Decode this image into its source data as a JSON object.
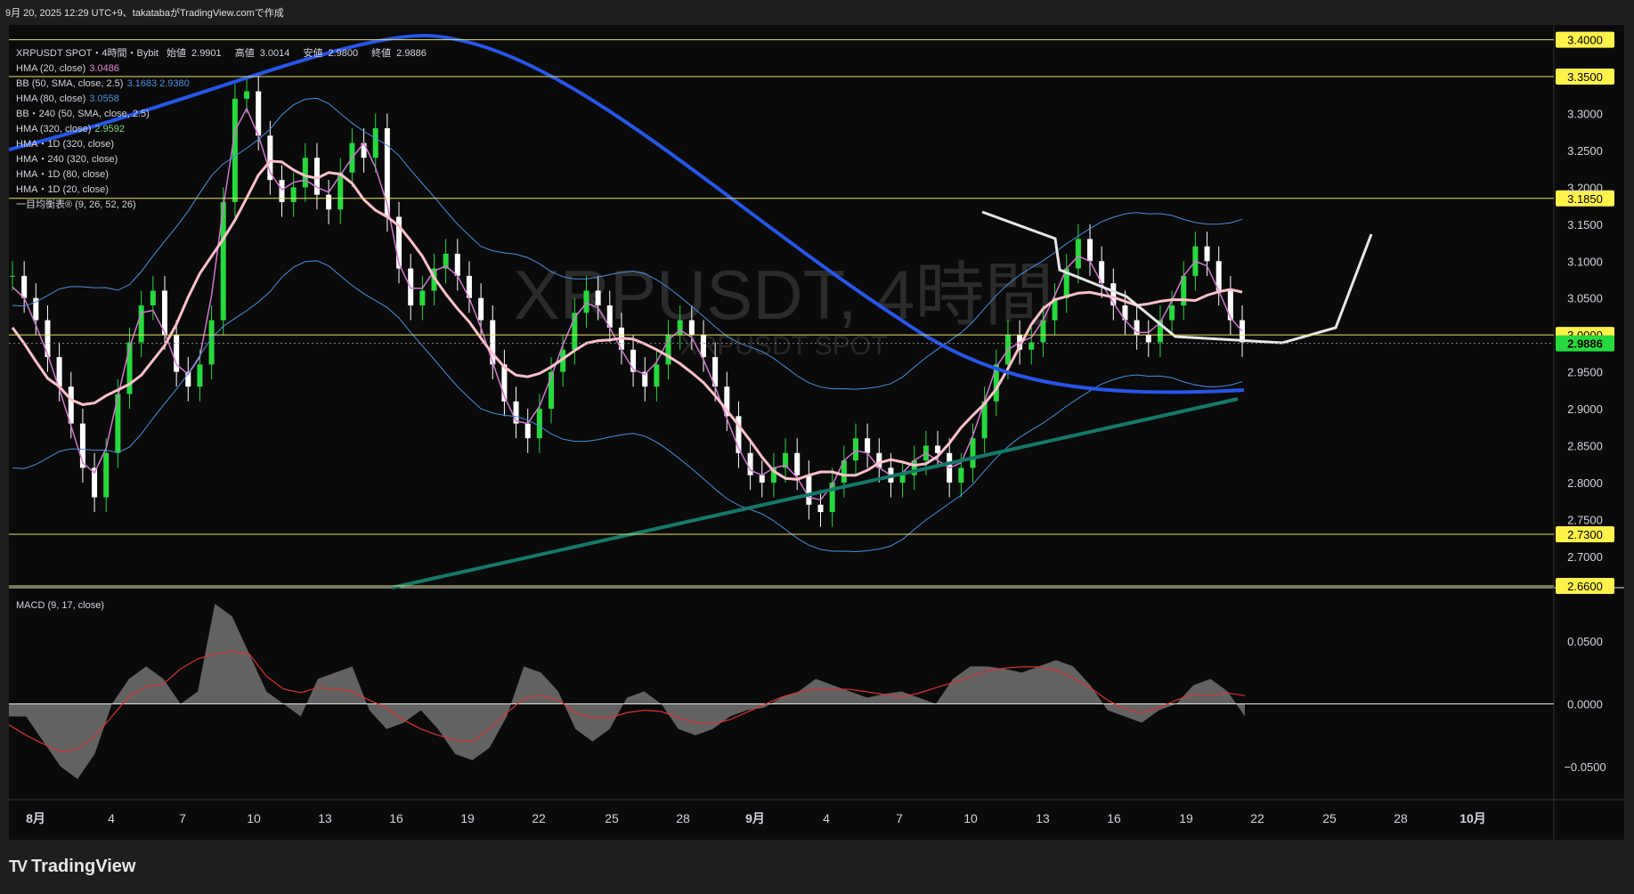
{
  "header": {
    "text": "9月 20, 2025 12:29 UTC+9、takatabaがTradingView.comで作成"
  },
  "legend": {
    "symbol": "XRPUSDT SPOT・4時間・Bybit",
    "ohlc": [
      {
        "label": "始値",
        "value": "2.9901"
      },
      {
        "label": "高値",
        "value": "3.0014"
      },
      {
        "label": "安値",
        "value": "2.9800"
      },
      {
        "label": "終値",
        "value": "2.9886"
      }
    ],
    "indicators": [
      {
        "name": "HMA (20, close)",
        "value": "3.0486",
        "color": "#e78ad8"
      },
      {
        "name": "BB (50, SMA, close, 2.5)",
        "value": "3.1683  2.9380",
        "color": "#4a90e2"
      },
      {
        "name": "HMA (80, close)",
        "value": "3.0558",
        "color": "#4a90e2"
      },
      {
        "name": "BB・240 (50, SMA, close, 2.5)",
        "value": "",
        "color": ""
      },
      {
        "name": "HMA (320, close)",
        "value": "2.9592",
        "color": "#7fd67f"
      },
      {
        "name": "HMA・1D (320, close)",
        "value": "",
        "color": ""
      },
      {
        "name": "HMA・240 (320, close)",
        "value": "",
        "color": ""
      },
      {
        "name": "HMA・1D (80, close)",
        "value": "",
        "color": ""
      },
      {
        "name": "HMA・1D (20, close)",
        "value": "",
        "color": ""
      },
      {
        "name": "一目均衡表® (9, 26, 52, 26)",
        "value": "",
        "color": ""
      }
    ]
  },
  "watermark": {
    "title": "XRPUSDT, 4時間",
    "subtitle": "XRPUSDT SPOT"
  },
  "macd_label": "MACD (9, 17, close)",
  "footer": {
    "logo": "TradingView",
    "logo_mark": "TV"
  },
  "colors": {
    "up": "#26d93c",
    "down": "#ffffff",
    "level": "#e7e36a",
    "hma80": "#ffc0cb",
    "hma320_1d": "#2456e8",
    "ichimoku_cloud": "#5a5a5a"
  },
  "chart_data": [
    {
      "type": "candlestick",
      "title": "XRPUSDT, 4時間",
      "ylim": [
        2.66,
        3.42
      ],
      "y_ticks": [
        "3.3000",
        "3.2500",
        "3.2000",
        "3.1500",
        "3.1000",
        "3.0500",
        "2.9500",
        "2.9000",
        "2.8500",
        "2.8000",
        "2.7500",
        "2.7000"
      ],
      "x_ticks": [
        "8月",
        "4",
        "7",
        "10",
        "13",
        "16",
        "19",
        "22",
        "25",
        "28",
        "9月",
        "4",
        "7",
        "10",
        "13",
        "16",
        "19",
        "22",
        "25",
        "28",
        "10月"
      ],
      "horizontal_levels": [
        "3.4000",
        "3.3500",
        "3.1850",
        "3.0000",
        "2.7300",
        "2.6600"
      ],
      "last_price": "2.9886",
      "close_series": [
        3.08,
        3.05,
        3.02,
        2.97,
        2.93,
        2.88,
        2.82,
        2.78,
        2.84,
        2.92,
        2.99,
        3.04,
        3.06,
        3.0,
        2.95,
        2.93,
        2.96,
        3.02,
        3.18,
        3.32,
        3.33,
        3.27,
        3.21,
        3.18,
        3.2,
        3.24,
        3.19,
        3.17,
        3.22,
        3.26,
        3.24,
        3.28,
        3.16,
        3.09,
        3.04,
        3.06,
        3.09,
        3.11,
        3.08,
        3.05,
        3.02,
        2.96,
        2.91,
        2.88,
        2.86,
        2.9,
        2.95,
        2.98,
        3.03,
        3.06,
        3.04,
        3.01,
        2.98,
        2.95,
        2.93,
        2.96,
        3.0,
        3.02,
        3.0,
        2.97,
        2.93,
        2.89,
        2.84,
        2.81,
        2.8,
        2.82,
        2.84,
        2.81,
        2.77,
        2.76,
        2.8,
        2.83,
        2.86,
        2.84,
        2.82,
        2.8,
        2.81,
        2.83,
        2.85,
        2.84,
        2.8,
        2.82,
        2.86,
        2.91,
        2.96,
        3.0,
        2.98,
        2.99,
        3.02,
        3.05,
        3.09,
        3.13,
        3.1,
        3.07,
        3.04,
        3.02,
        3.0,
        2.99,
        3.02,
        3.04,
        3.08,
        3.12,
        3.1,
        3.06,
        3.02,
        2.99
      ],
      "ohlc_last": {
        "open": 2.9901,
        "high": 3.0014,
        "low": 2.98,
        "close": 2.9886
      }
    },
    {
      "type": "bar",
      "title": "MACD (9, 17, close)",
      "ylim": [
        -0.075,
        0.09
      ],
      "y_ticks": [
        "0.0500",
        "0.0000",
        "−0.0500"
      ],
      "values": [
        -0.01,
        -0.01,
        -0.03,
        -0.05,
        -0.06,
        -0.04,
        0.0,
        0.02,
        0.03,
        0.02,
        0.0,
        0.01,
        0.08,
        0.07,
        0.04,
        0.01,
        0.0,
        -0.01,
        0.02,
        0.025,
        0.03,
        -0.005,
        -0.02,
        -0.015,
        -0.005,
        -0.02,
        -0.04,
        -0.045,
        -0.035,
        -0.01,
        0.03,
        0.025,
        0.01,
        -0.02,
        -0.03,
        -0.02,
        0.005,
        0.01,
        0.0,
        -0.02,
        -0.025,
        -0.02,
        -0.01,
        -0.005,
        -0.003,
        0.005,
        0.01,
        0.02,
        0.015,
        0.01,
        0.005,
        0.008,
        0.01,
        0.005,
        0.0,
        0.02,
        0.03,
        0.03,
        0.028,
        0.025,
        0.03,
        0.035,
        0.03,
        0.015,
        -0.005,
        -0.01,
        -0.015,
        -0.005,
        0.0,
        0.015,
        0.02,
        0.01,
        -0.01
      ]
    }
  ]
}
